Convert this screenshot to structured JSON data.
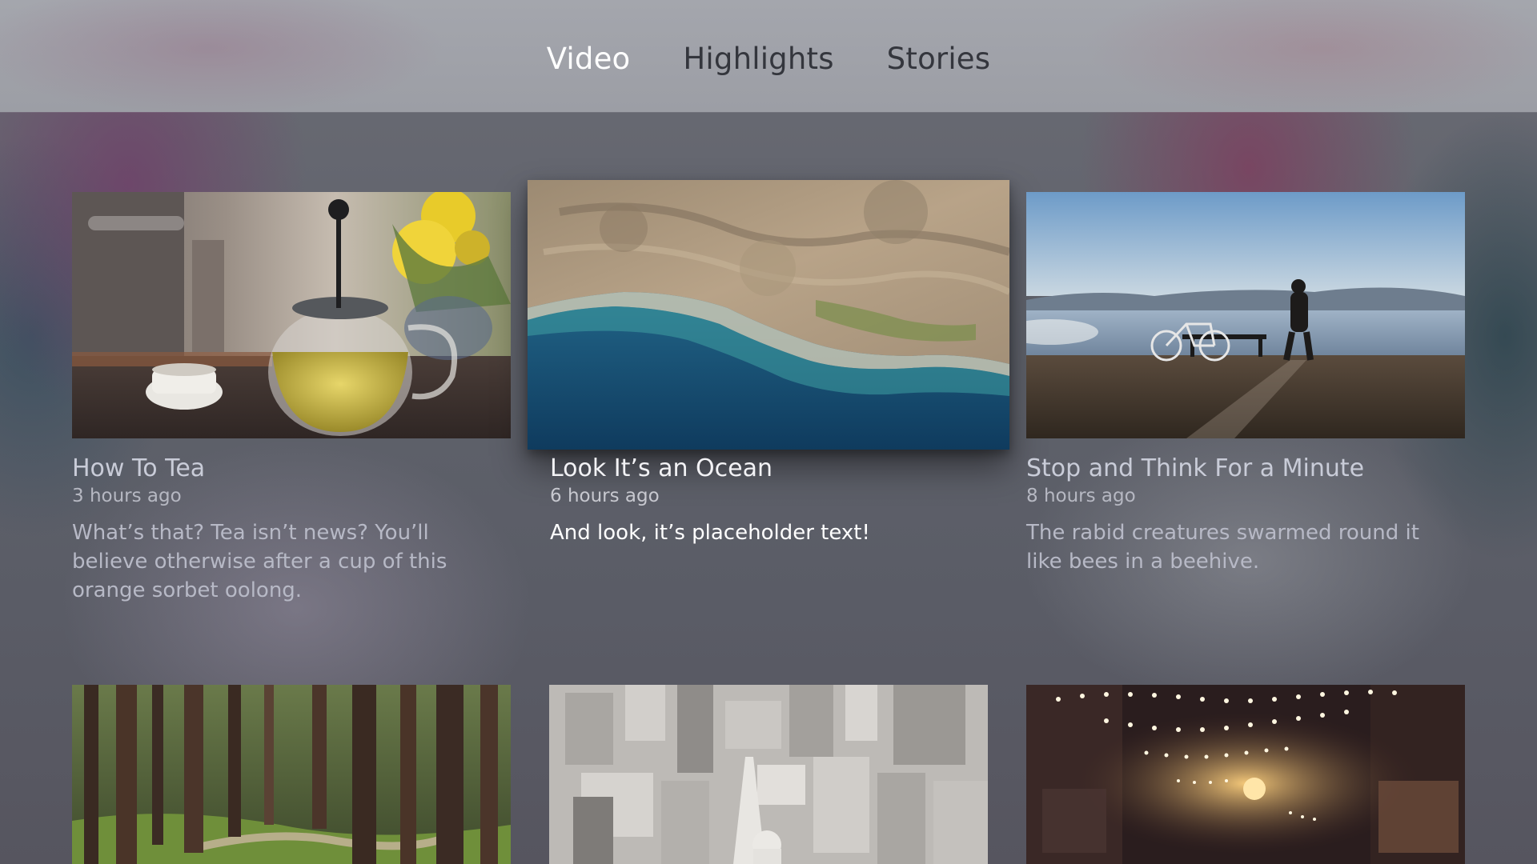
{
  "nav": {
    "tabs": [
      {
        "label": "Video",
        "active": true
      },
      {
        "label": "Highlights",
        "active": false
      },
      {
        "label": "Stories",
        "active": false
      }
    ]
  },
  "cards": [
    {
      "title": "How To Tea",
      "time": "3 hours ago",
      "description": "What’s that? Tea isn’t news? You’ll believe otherwise after a cup of this orange sorbet oolong.",
      "image": "teapot-photo",
      "focused": false
    },
    {
      "title": "Look It’s an Ocean",
      "time": "6 hours ago",
      "description": "And look, it’s placeholder text!",
      "image": "coastline-aerial-photo",
      "focused": true
    },
    {
      "title": "Stop and Think For a Minute",
      "time": "8 hours ago",
      "description": "The rabid creatures swarmed round it like bees in a beehive.",
      "image": "bicycle-by-sea-photo",
      "focused": false
    },
    {
      "image": "forest-trees-photo"
    },
    {
      "image": "city-aerial-photo"
    },
    {
      "image": "string-lights-street-photo"
    }
  ],
  "colors": {
    "active_tab": "#ffffff",
    "inactive_tab": "#34363d",
    "nav_background": "#a0a2a9"
  }
}
